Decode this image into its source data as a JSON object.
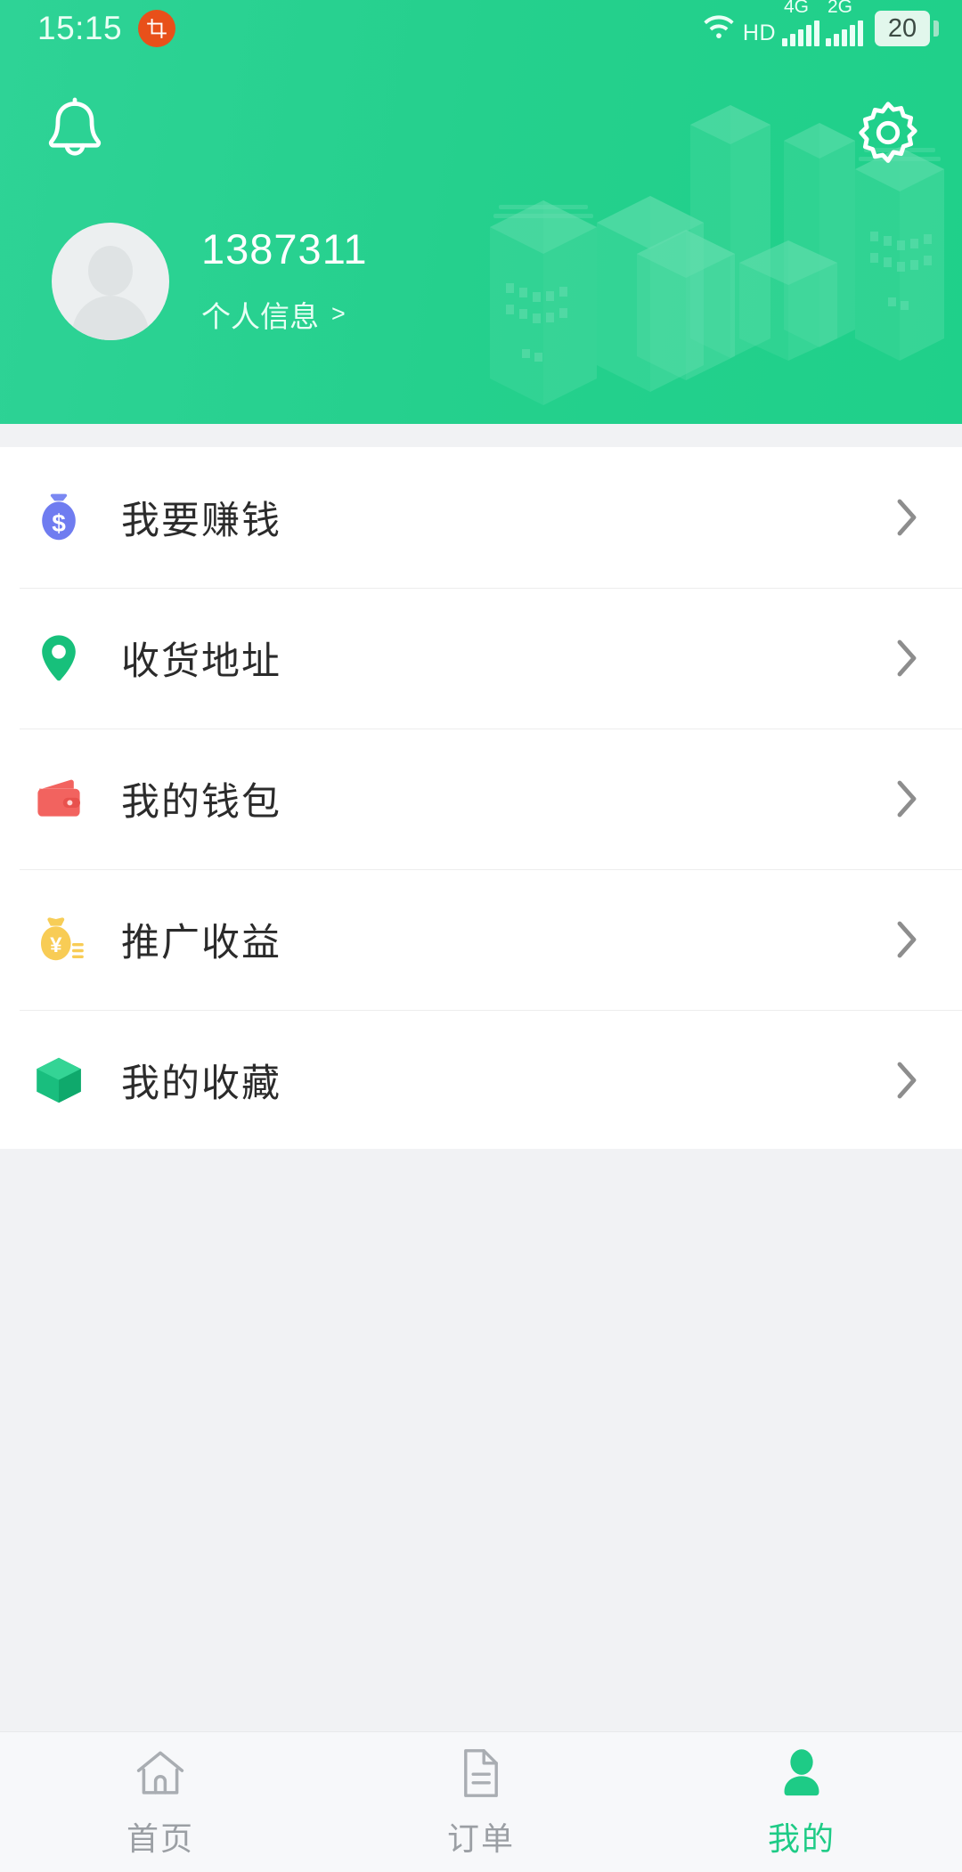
{
  "theme": {
    "primary": "#25d08d",
    "accent_green": "#1ecb86",
    "page_bg": "#f1f2f4",
    "card_bg": "#ffffff",
    "text_dark": "#2b2b2b",
    "text_muted": "#9b9fa4"
  },
  "status_bar": {
    "time": "15:15",
    "screenshot_icon": "screenshot-crop-icon",
    "wifi_icon": "wifi-icon",
    "hd_label": "HD",
    "sim1_label": "4G",
    "sim2_label": "2G",
    "battery_level": "20"
  },
  "header": {
    "bell_icon": "bell-icon",
    "settings_icon": "gear-icon",
    "background_art": "isometric-city-buildings",
    "avatar_icon": "default-avatar-icon",
    "username": "1387311",
    "profile_link_label": "个人信息",
    "profile_link_arrow": ">"
  },
  "menu": {
    "items": [
      {
        "id": "earn-money",
        "label": "我要赚钱",
        "icon": "money-bag-dollar-icon",
        "icon_color": "#6f7cf0",
        "chevron": "chevron-right-icon"
      },
      {
        "id": "shipping-address",
        "label": "收货地址",
        "icon": "location-pin-icon",
        "icon_color": "#17c07b",
        "chevron": "chevron-right-icon"
      },
      {
        "id": "my-wallet",
        "label": "我的钱包",
        "icon": "wallet-icon",
        "icon_color": "#f2635f",
        "chevron": "chevron-right-icon"
      },
      {
        "id": "promotion-income",
        "label": "推广收益",
        "icon": "money-bag-yuan-icon",
        "icon_color": "#f6c council",
        "chevron": "chevron-right-icon"
      },
      {
        "id": "my-favorites",
        "label": "我的收藏",
        "icon": "cube-box-icon",
        "icon_color": "#19be7e",
        "chevron": "chevron-right-icon"
      }
    ]
  },
  "tabbar": {
    "tabs": [
      {
        "id": "home",
        "label": "首页",
        "icon": "home-icon",
        "active": false
      },
      {
        "id": "orders",
        "label": "订单",
        "icon": "document-icon",
        "active": false
      },
      {
        "id": "mine",
        "label": "我的",
        "icon": "person-icon",
        "active": true
      }
    ]
  }
}
